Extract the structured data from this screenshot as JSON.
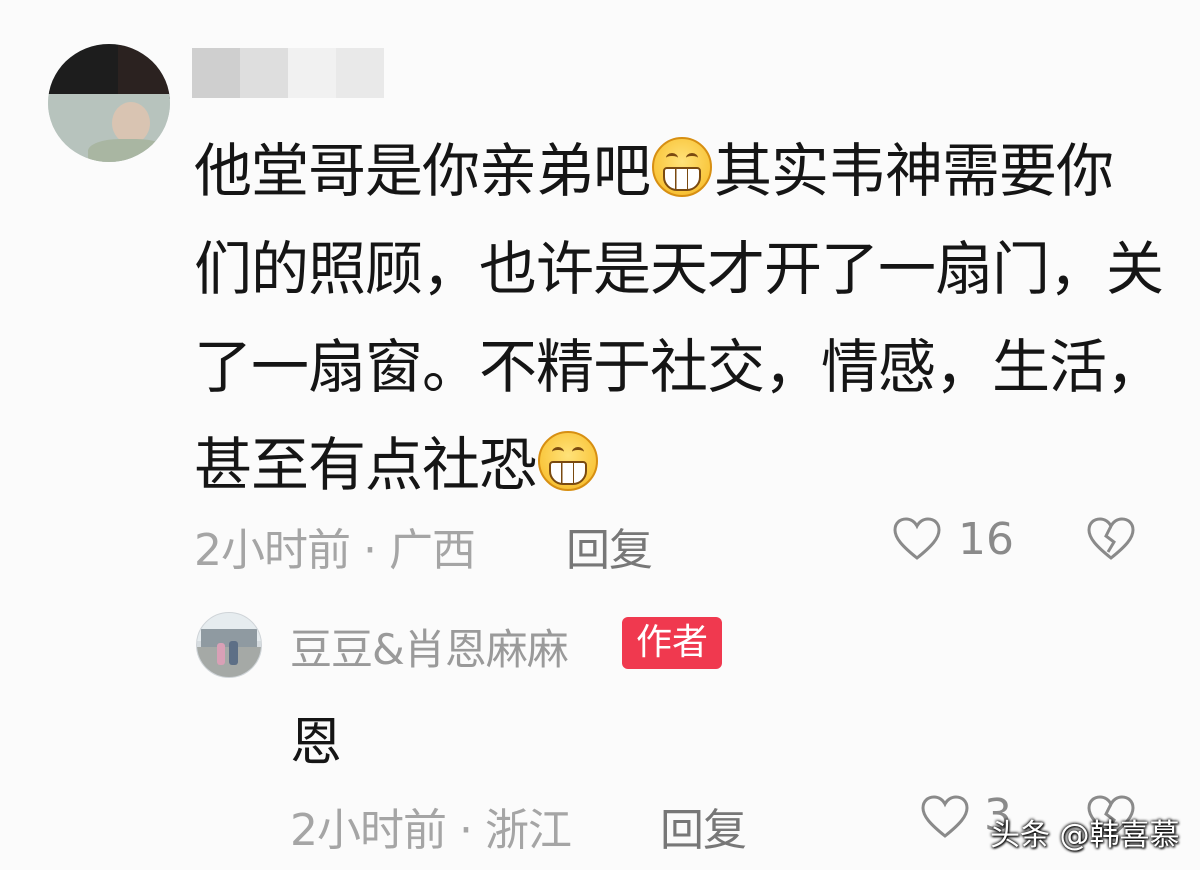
{
  "comment": {
    "line1_a": "他堂哥是你亲弟吧",
    "line1_emoji": "grinning-emoji",
    "line1_b": "其实韦神需要你",
    "line2": "们的照顾，也许是天才开了一扇门，关",
    "line3": "了一扇窗。不精于社交，情感，生活，",
    "line4_a": "甚至有点社恐",
    "line4_emoji": "grinning-emoji",
    "time": "2小时前",
    "separator": "·",
    "location": "广西",
    "reply_label": "回复",
    "like_count": "16"
  },
  "reply": {
    "username": "豆豆&肖恩麻麻",
    "badge": "作者",
    "text": "恩",
    "time": "2小时前",
    "separator": "·",
    "location": "浙江",
    "reply_label": "回复",
    "like_count": "3"
  },
  "watermark": "头条 @韩喜慕",
  "colors": {
    "badge_bg": "#f0394f",
    "meta_gray": "#a5a5a5",
    "background": "#fbfbfb"
  },
  "icons": [
    "heart-outline-icon",
    "broken-heart-icon"
  ]
}
